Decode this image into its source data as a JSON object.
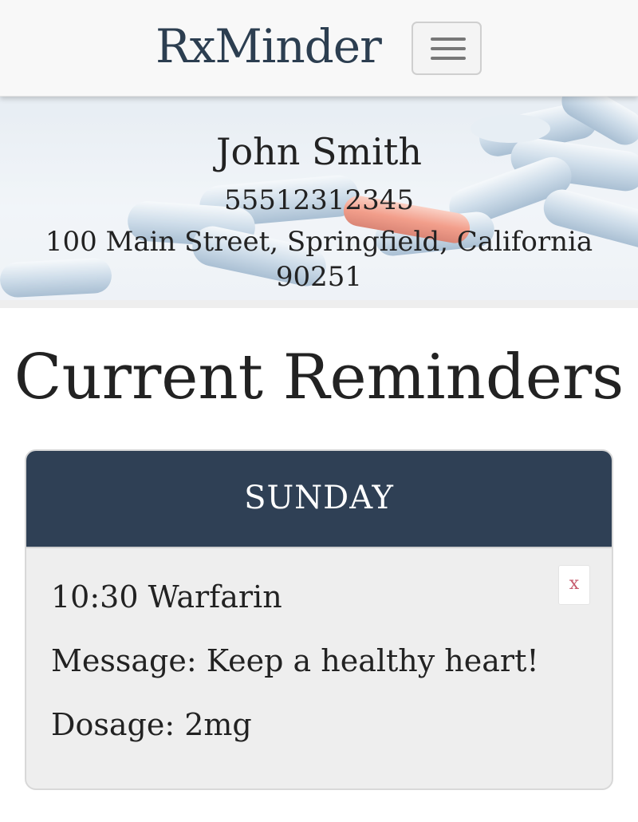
{
  "navbar": {
    "brand": "RxMinder",
    "toggle_icon": "hamburger-menu-icon"
  },
  "hero": {
    "name": "John Smith",
    "phone": "55512312345",
    "address": "100 Main Street, Springfield, California 90251",
    "background_image": "pills-photo"
  },
  "page": {
    "title": "Current Reminders"
  },
  "reminders": [
    {
      "day": "SUNDAY",
      "title": "10:30 Warfarin",
      "message": "Message: Keep a healthy heart!",
      "dosage": "Dosage: 2mg",
      "delete_label": "x"
    }
  ],
  "colors": {
    "brand_text": "#2c3e50",
    "card_header": "#2f4055",
    "card_body": "#eeeeee",
    "delete_text": "#c65b6e"
  }
}
